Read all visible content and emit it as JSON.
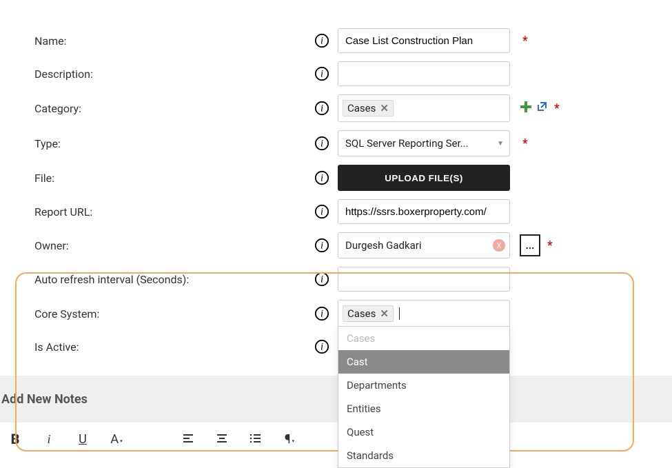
{
  "fields": {
    "name": {
      "label": "Name:",
      "value": "Case List Construction Plan",
      "required": true
    },
    "description": {
      "label": "Description:",
      "value": ""
    },
    "category": {
      "label": "Category:",
      "tag": "Cases",
      "required": true
    },
    "type": {
      "label": "Type:",
      "selected": "SQL Server Reporting Ser...",
      "required": true
    },
    "file": {
      "label": "File:",
      "button": "UPLOAD FILE(S)"
    },
    "report_url": {
      "label": "Report URL:",
      "value": "https://ssrs.boxerproperty.com/"
    },
    "owner": {
      "label": "Owner:",
      "value": "Durgesh Gadkari",
      "required": true,
      "picker": "..."
    },
    "auto_refresh": {
      "label": "Auto refresh interval (Seconds):",
      "value": ""
    },
    "core_system": {
      "label": "Core System:",
      "tag": "Cases"
    },
    "is_active": {
      "label": "Is Active:"
    }
  },
  "dropdown": {
    "disabled_option": "Cases",
    "selected_option": "Cast",
    "options": [
      "Departments",
      "Entities",
      "Quest",
      "Standards"
    ]
  },
  "notes": {
    "heading": "Add New Notes"
  },
  "toolbar": {
    "bold": "B",
    "italic": "i",
    "underline": "U",
    "font": "A"
  }
}
